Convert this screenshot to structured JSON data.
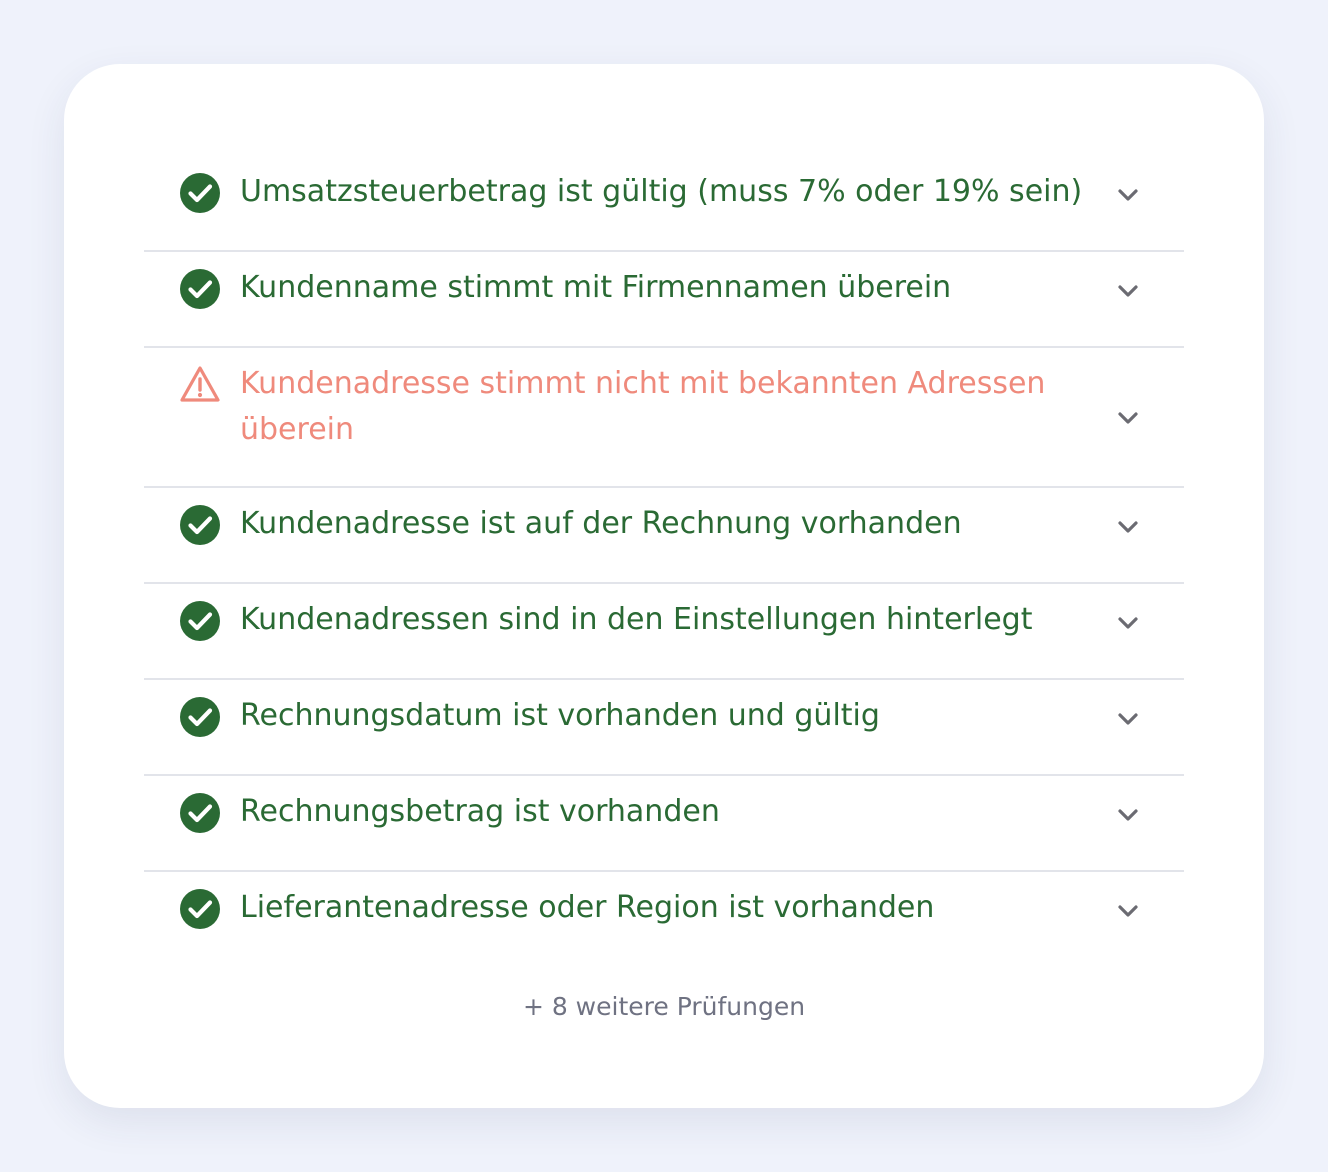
{
  "colors": {
    "background": "#eff2fb",
    "card": "#ffffff",
    "success": "#2a6a34",
    "warning": "#ef8a7c",
    "chevron": "#6b6b72",
    "muted_text": "#6f7282",
    "divider": "#e2e4ea"
  },
  "checks": [
    {
      "status": "success",
      "icon": "check-circle-icon",
      "label": "Umsatzsteuerbetrag ist gültig (muss 7% oder 19% sein)"
    },
    {
      "status": "success",
      "icon": "check-circle-icon",
      "label": "Kundenname stimmt mit Firmennamen überein"
    },
    {
      "status": "warning",
      "icon": "warning-triangle-icon",
      "label": "Kundenadresse stimmt nicht mit bekannten Adressen überein"
    },
    {
      "status": "success",
      "icon": "check-circle-icon",
      "label": "Kundenadresse ist auf der Rechnung vorhanden"
    },
    {
      "status": "success",
      "icon": "check-circle-icon",
      "label": "Kundenadressen sind in den Einstellungen hinterlegt"
    },
    {
      "status": "success",
      "icon": "check-circle-icon",
      "label": "Rechnungsdatum ist vorhanden und gültig"
    },
    {
      "status": "success",
      "icon": "check-circle-icon",
      "label": "Rechnungsbetrag ist vorhanden"
    },
    {
      "status": "success",
      "icon": "check-circle-icon",
      "label": "Lieferantenadresse oder Region ist vorhanden"
    }
  ],
  "more_checks_label": "+ 8 weitere Prüfungen"
}
